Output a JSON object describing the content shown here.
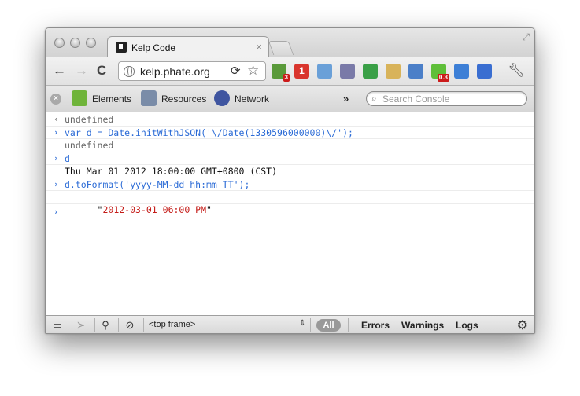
{
  "tab": {
    "title": "Kelp Code",
    "close": "×"
  },
  "toolbar": {
    "back": "←",
    "forward": "→",
    "reload": "C",
    "url": "kelp.phate.org",
    "extensions": [
      {
        "name": "badge-ext",
        "badge": "3",
        "color": "#5a9a3a"
      },
      {
        "name": "number-ext",
        "label": "1",
        "color": "#d9352d"
      },
      {
        "name": "puzzle-ext",
        "color": "#6aa0d8"
      },
      {
        "name": "user-block-ext",
        "color": "#7a7aa8"
      },
      {
        "name": "sync-ext",
        "color": "#3aa047"
      },
      {
        "name": "cookie-ext",
        "color": "#d8b35a"
      },
      {
        "name": "inspect-ext",
        "color": "#4b7fc8"
      },
      {
        "name": "color-ext",
        "badge": "0.3",
        "color": "#5fbf39"
      },
      {
        "name": "download-ext",
        "color": "#3d7fd6"
      },
      {
        "name": "bookmark-star-ext",
        "color": "#3a6ed1"
      }
    ]
  },
  "devtools": {
    "panels": [
      {
        "label": "Elements",
        "color": "#6fb43a"
      },
      {
        "label": "Resources",
        "color": "#7a8ca8"
      },
      {
        "label": "Network",
        "color": "#3f55a0"
      }
    ],
    "more": "»",
    "search_placeholder": "Search Console"
  },
  "console": {
    "lines": [
      {
        "glyph": "‹",
        "kind": "res",
        "text": "undefined"
      },
      {
        "glyph": "›",
        "kind": "cmd",
        "text": "var d = Date.initWithJSON('\\/Date(1330596000000)\\/');"
      },
      {
        "glyph": "",
        "kind": "res",
        "text": "undefined"
      },
      {
        "glyph": "›",
        "kind": "cmd",
        "text": "d"
      },
      {
        "glyph": "",
        "kind": "plain",
        "text": "Thu Mar 01 2012 18:00:00 GMT+0800 (CST)"
      },
      {
        "glyph": "›",
        "kind": "cmd",
        "text": "d.toFormat('yyyy-MM-dd hh:mm TT');"
      }
    ],
    "string_result": {
      "quote": "\"",
      "value": "2012-03-01 06:00 PM"
    },
    "prompt": "›"
  },
  "statusbar": {
    "frame": "<top frame>",
    "frame_arrow": "⇕",
    "filters": [
      "All",
      "Errors",
      "Warnings",
      "Logs"
    ]
  }
}
